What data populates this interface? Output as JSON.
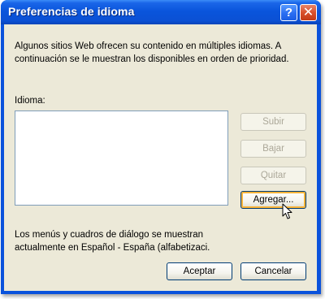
{
  "window": {
    "title": "Preferencias de idioma",
    "help_button": "?",
    "close_button": "✕"
  },
  "description": {
    "line1": "Algunos sitios Web ofrecen su contenido en múltiples idiomas. A",
    "line2": "continuación se le muestran los disponibles en orden de prioridad."
  },
  "language_list": {
    "label": "Idioma:",
    "items": []
  },
  "side_buttons": {
    "subir": "Subir",
    "bajar": "Bajar",
    "quitar": "Quitar",
    "agregar": "Agregar..."
  },
  "status": {
    "line1": "Los menús y cuadros de diálogo se muestran",
    "line2": "actualmente en Español - España (alfabetizaci."
  },
  "footer_buttons": {
    "accept": "Aceptar",
    "cancel": "Cancelar"
  },
  "colors": {
    "titlebar": "#0a55dc",
    "dialog_bg": "#ece9d8",
    "close_button": "#d8502c",
    "focus_highlight": "#f8b339"
  }
}
